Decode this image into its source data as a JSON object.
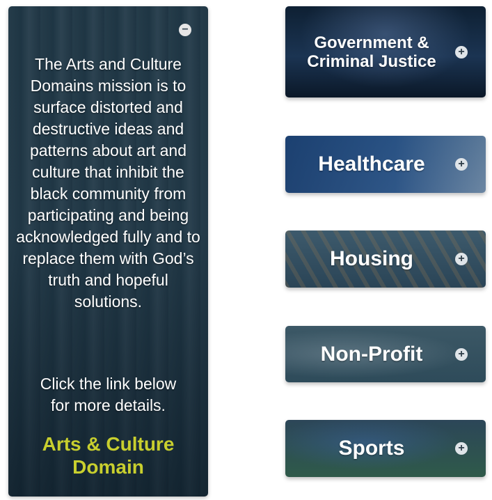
{
  "expanded_panel": {
    "mission_text": "The Arts and Culture Domains mission is to surface distorted and destructive ideas and patterns about art and culture that inhibit the black community from participating and being acknowledged fully and to replace them with God’s truth and hopeful solutions.",
    "click_note": "Click the link below for more details.",
    "link_label": "Arts & Culture Domain",
    "collapse_icon": "minus-circle-icon"
  },
  "domains": [
    {
      "title": "Government & Criminal Justice",
      "icon": "plus-circle-icon"
    },
    {
      "title": "Healthcare",
      "icon": "plus-circle-icon"
    },
    {
      "title": "Housing",
      "icon": "plus-circle-icon"
    },
    {
      "title": "Non-Profit",
      "icon": "plus-circle-icon"
    },
    {
      "title": "Sports",
      "icon": "plus-circle-icon"
    }
  ],
  "colors": {
    "link": "#c8cf2e",
    "text": "#ffffff",
    "toggle_icon_bg": "#e6e6e6"
  }
}
